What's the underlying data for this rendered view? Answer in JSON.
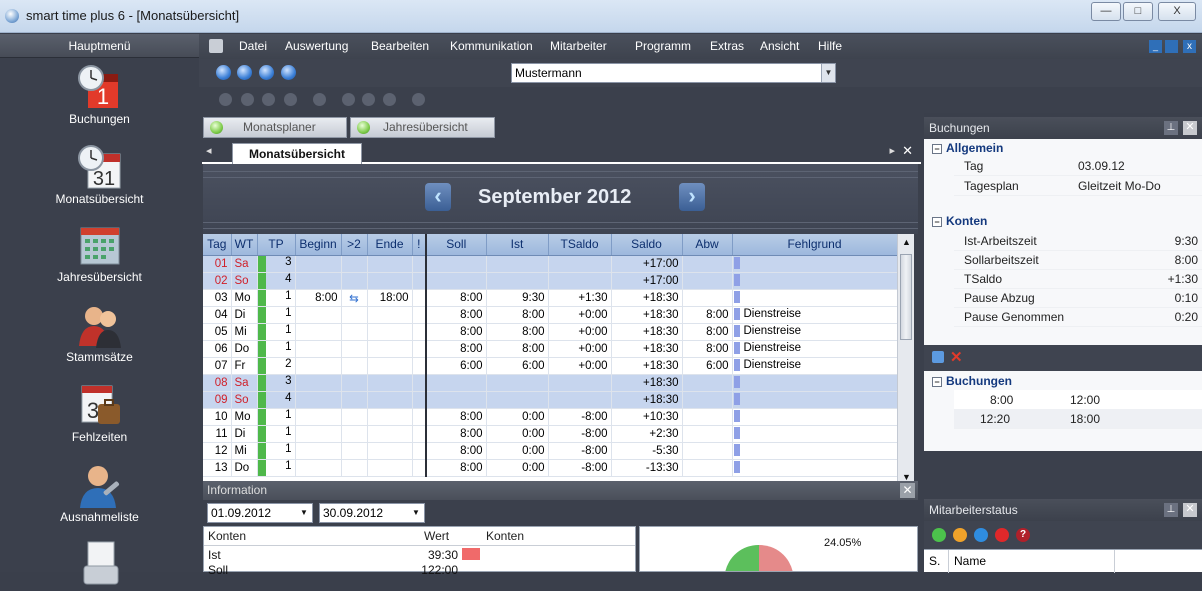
{
  "window": {
    "title": "smart time plus 6 - [Monatsübersicht]",
    "min": "—",
    "max": "□",
    "close": "X"
  },
  "sidebar": {
    "header": "Hauptmenü",
    "items": [
      {
        "label": "Buchungen",
        "icon": "clock-calendar-icon"
      },
      {
        "label": "Monatsübersicht",
        "icon": "clock-calendar-31-icon"
      },
      {
        "label": "Jahresübersicht",
        "icon": "year-calendar-icon"
      },
      {
        "label": "Stammsätze",
        "icon": "people-icon"
      },
      {
        "label": "Fehlzeiten",
        "icon": "calendar-suitcase-icon"
      },
      {
        "label": "Ausnahmeliste",
        "icon": "user-wrench-icon"
      },
      {
        "label": "",
        "icon": "document-printer-icon"
      }
    ]
  },
  "menu": [
    "Datei",
    "Auswertung",
    "Bearbeiten",
    "Kommunikation",
    "Mitarbeiter",
    "Programm",
    "Extras",
    "Ansicht",
    "Hilfe"
  ],
  "employee_select": {
    "value": "Mustermann"
  },
  "subtabs": [
    "Monatsplaner",
    "Jahresübersicht"
  ],
  "doc_tab": "Monatsübersicht",
  "month_title": "September 2012",
  "grid": {
    "headers": [
      "Tag",
      "WT",
      "TP",
      "Beginn",
      ">2",
      "Ende",
      "!",
      "Soll",
      "Ist",
      "TSaldo",
      "Saldo",
      "Abw",
      "Fehlgrund"
    ],
    "rows": [
      {
        "tag": "01",
        "wt": "Sa",
        "tp": "3",
        "beginn": "",
        "gt2": "",
        "ende": "",
        "soll": "",
        "ist": "",
        "tsaldo": "",
        "saldo": "+17:00",
        "abw": "",
        "fehlgrund": "",
        "weekend": true
      },
      {
        "tag": "02",
        "wt": "So",
        "tp": "4",
        "beginn": "",
        "gt2": "",
        "ende": "",
        "soll": "",
        "ist": "",
        "tsaldo": "",
        "saldo": "+17:00",
        "abw": "",
        "fehlgrund": "",
        "weekend": true
      },
      {
        "tag": "03",
        "wt": "Mo",
        "tp": "1",
        "beginn": "8:00",
        "gt2": "⇆",
        "ende": "18:00",
        "soll": "8:00",
        "ist": "9:30",
        "tsaldo": "+1:30",
        "saldo": "+18:30",
        "abw": "",
        "fehlgrund": "",
        "weekend": false
      },
      {
        "tag": "04",
        "wt": "Di",
        "tp": "1",
        "beginn": "",
        "gt2": "",
        "ende": "",
        "soll": "8:00",
        "ist": "8:00",
        "tsaldo": "+0:00",
        "saldo": "+18:30",
        "abw": "8:00",
        "fehlgrund": "Dienstreise",
        "weekend": false
      },
      {
        "tag": "05",
        "wt": "Mi",
        "tp": "1",
        "beginn": "",
        "gt2": "",
        "ende": "",
        "soll": "8:00",
        "ist": "8:00",
        "tsaldo": "+0:00",
        "saldo": "+18:30",
        "abw": "8:00",
        "fehlgrund": "Dienstreise",
        "weekend": false
      },
      {
        "tag": "06",
        "wt": "Do",
        "tp": "1",
        "beginn": "",
        "gt2": "",
        "ende": "",
        "soll": "8:00",
        "ist": "8:00",
        "tsaldo": "+0:00",
        "saldo": "+18:30",
        "abw": "8:00",
        "fehlgrund": "Dienstreise",
        "weekend": false
      },
      {
        "tag": "07",
        "wt": "Fr",
        "tp": "2",
        "beginn": "",
        "gt2": "",
        "ende": "",
        "soll": "6:00",
        "ist": "6:00",
        "tsaldo": "+0:00",
        "saldo": "+18:30",
        "abw": "6:00",
        "fehlgrund": "Dienstreise",
        "weekend": false
      },
      {
        "tag": "08",
        "wt": "Sa",
        "tp": "3",
        "beginn": "",
        "gt2": "",
        "ende": "",
        "soll": "",
        "ist": "",
        "tsaldo": "",
        "saldo": "+18:30",
        "abw": "",
        "fehlgrund": "",
        "weekend": true
      },
      {
        "tag": "09",
        "wt": "So",
        "tp": "4",
        "beginn": "",
        "gt2": "",
        "ende": "",
        "soll": "",
        "ist": "",
        "tsaldo": "",
        "saldo": "+18:30",
        "abw": "",
        "fehlgrund": "",
        "weekend": true
      },
      {
        "tag": "10",
        "wt": "Mo",
        "tp": "1",
        "beginn": "",
        "gt2": "",
        "ende": "",
        "soll": "8:00",
        "ist": "0:00",
        "tsaldo": "-8:00",
        "saldo": "+10:30",
        "abw": "",
        "fehlgrund": "",
        "weekend": false
      },
      {
        "tag": "11",
        "wt": "Di",
        "tp": "1",
        "beginn": "",
        "gt2": "",
        "ende": "",
        "soll": "8:00",
        "ist": "0:00",
        "tsaldo": "-8:00",
        "saldo": "+2:30",
        "abw": "",
        "fehlgrund": "",
        "weekend": false
      },
      {
        "tag": "12",
        "wt": "Mi",
        "tp": "1",
        "beginn": "",
        "gt2": "",
        "ende": "",
        "soll": "8:00",
        "ist": "0:00",
        "tsaldo": "-8:00",
        "saldo": "-5:30",
        "abw": "",
        "fehlgrund": "",
        "weekend": false
      },
      {
        "tag": "13",
        "wt": "Do",
        "tp": "1",
        "beginn": "",
        "gt2": "",
        "ende": "",
        "soll": "8:00",
        "ist": "0:00",
        "tsaldo": "-8:00",
        "saldo": "-13:30",
        "abw": "",
        "fehlgrund": "",
        "weekend": false
      }
    ]
  },
  "information": {
    "title": "Information",
    "date_from": "01.09.2012",
    "date_to": "30.09.2012",
    "col_konten": "Konten",
    "col_wert": "Wert",
    "col_konten2": "Konten",
    "rows": [
      {
        "label": "Ist",
        "value": "39:30"
      },
      {
        "label": "Soll",
        "value": "122:00"
      }
    ],
    "pie_label": "24.05%"
  },
  "right_panel": {
    "title": "Buchungen",
    "allgemein": {
      "title": "Allgemein",
      "rows": [
        {
          "k": "Tag",
          "v": "03.09.12"
        },
        {
          "k": "Tagesplan",
          "v": "Gleitzeit Mo-Do"
        }
      ]
    },
    "konten": {
      "title": "Konten",
      "rows": [
        {
          "k": "Ist-Arbeitszeit",
          "v": "9:30"
        },
        {
          "k": "Sollarbeitszeit",
          "v": "8:00"
        },
        {
          "k": "TSaldo",
          "v": "+1:30"
        },
        {
          "k": "Pause Abzug",
          "v": "0:10"
        },
        {
          "k": "Pause Genommen",
          "v": "0:20"
        }
      ]
    },
    "buchungen": {
      "title": "Buchungen",
      "rows": [
        {
          "a": "8:00",
          "b": "12:00"
        },
        {
          "a": "12:20",
          "b": "18:00"
        }
      ]
    }
  },
  "status_panel": {
    "title": "Mitarbeiterstatus",
    "col_s": "S.",
    "col_name": "Name"
  },
  "colors": {
    "accent": "#9db8dd",
    "weekend_row": "#c6d5ee",
    "tp_green": "#4fb84a",
    "abw_bar": "#8fa0e6"
  }
}
